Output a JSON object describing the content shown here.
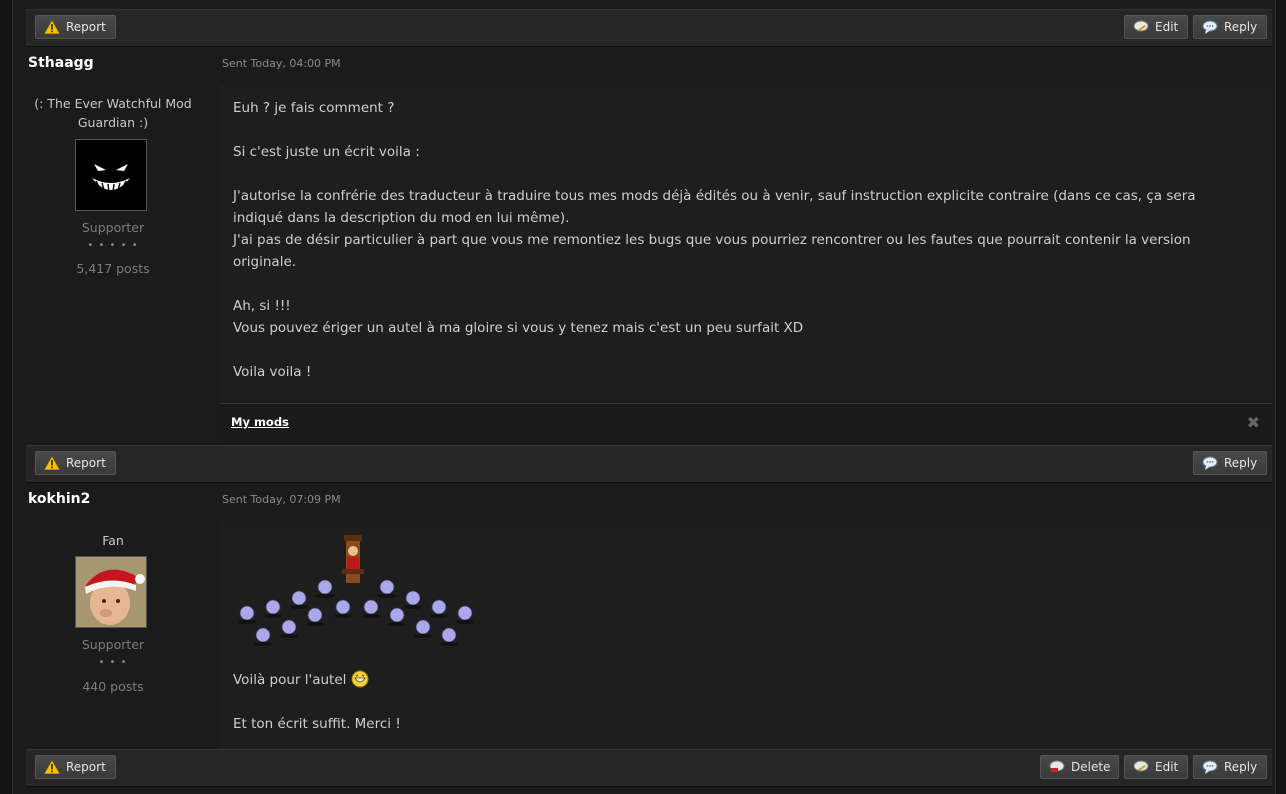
{
  "buttons": {
    "report": "Report",
    "edit": "Edit",
    "reply": "Reply",
    "delete": "Delete"
  },
  "posts": [
    {
      "author": "Sthaagg",
      "title": "(: The Ever Watchful Mod Guardian :)",
      "group": "Supporter",
      "pips": "• • • • •",
      "post_count": "5,417 posts",
      "sent": "Sent Today, 04:00 PM",
      "lines": [
        "Euh ? je fais comment ?",
        "",
        "Si c'est juste un écrit voila :",
        "",
        "J'autorise la confrérie des traducteur à traduire tous mes mods déjà édités ou à venir, sauf instruction explicite contraire (dans ce cas, ça sera indiqué dans la description du mod en lui même).",
        "J'ai pas de désir particulier à part que vous me remontiez les bugs que vous pourriez rencontrer ou les fautes que pourrait contenir la version originale.",
        "",
        "Ah, si !!!",
        "Vous pouvez ériger un autel à ma gloire si vous y tenez mais c'est un peu surfait XD",
        "",
        "Voila voila !"
      ],
      "signature_link": "My mods"
    },
    {
      "author": "kokhin2",
      "title": "Fan",
      "group": "Supporter",
      "pips": "• • •",
      "post_count": "440 posts",
      "sent": "Sent Today, 07:09 PM",
      "line1": "Voilà pour l'autel",
      "line2": "Et ton écrit suffit. Merci !"
    }
  ]
}
